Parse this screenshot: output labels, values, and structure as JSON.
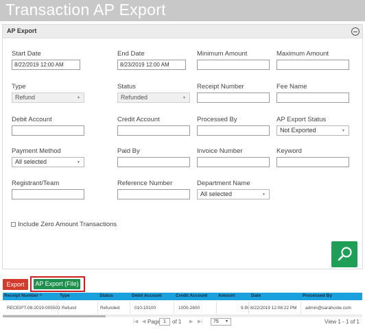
{
  "page": {
    "title": "Transaction AP Export"
  },
  "panel": {
    "title": "AP Export"
  },
  "fields": {
    "start_date": {
      "label": "Start Date",
      "value": "8/22/2019 12:00 AM"
    },
    "end_date": {
      "label": "End Date",
      "value": "8/23/2019 12:00 AM"
    },
    "minimum_amount": {
      "label": "Minimum Amount",
      "value": ""
    },
    "maximum_amount": {
      "label": "Maximum Amount",
      "value": ""
    },
    "type": {
      "label": "Type",
      "value": "Refund"
    },
    "status": {
      "label": "Status",
      "value": "Refunded"
    },
    "receipt_number": {
      "label": "Receipt Number",
      "value": ""
    },
    "fee_name": {
      "label": "Fee Name",
      "value": ""
    },
    "debit_account": {
      "label": "Debit Account",
      "value": ""
    },
    "credit_account": {
      "label": "Credit Account",
      "value": ""
    },
    "processed_by": {
      "label": "Processed By",
      "value": ""
    },
    "ap_export_status": {
      "label": "AP Export Status",
      "value": "Not Exported"
    },
    "payment_method": {
      "label": "Payment Method",
      "value": "All selected"
    },
    "paid_by": {
      "label": "Paid By",
      "value": ""
    },
    "invoice_number": {
      "label": "Invoice Number",
      "value": ""
    },
    "keyword": {
      "label": "Keyword",
      "value": ""
    },
    "registrant_team": {
      "label": "Registrant/Team",
      "value": ""
    },
    "reference_number": {
      "label": "Reference Number",
      "value": ""
    },
    "department_name": {
      "label": "Department Name",
      "value": "All selected"
    }
  },
  "include_zero": {
    "label": "Include Zero Amount Transactions",
    "checked": false
  },
  "buttons": {
    "search_icon": "search-icon",
    "export": "Export",
    "ap_export_file": "AP Export (File)"
  },
  "colors": {
    "header_bar": "#c8c8c8",
    "grid_header": "#1aa0dc",
    "search_green": "#1f9e58",
    "export_red": "#d23b2b",
    "ap_export_green": "#1e8f4c",
    "highlight_red": "#c9201f"
  },
  "grid": {
    "columns": [
      "Receipt Number",
      "Type",
      "Status",
      "Debit Account",
      "Credit Account",
      "Amount",
      "Date",
      "Processed By"
    ],
    "sort_indicator": "^",
    "rows": [
      [
        "RECEIPT-08-2019-005503",
        "Refund",
        "Refunded",
        "010-10100",
        "1000-2800",
        "9.99",
        "8/22/2019 12:08:22 PM",
        "admin@sarahcote.com"
      ]
    ],
    "pager": {
      "first": "|◀",
      "prev": "◀",
      "page_label": "Page",
      "page": "1",
      "of_label": "of 1",
      "next": "▶",
      "last": "▶|",
      "page_size": "75",
      "info": "View 1 - 1 of 1"
    }
  }
}
